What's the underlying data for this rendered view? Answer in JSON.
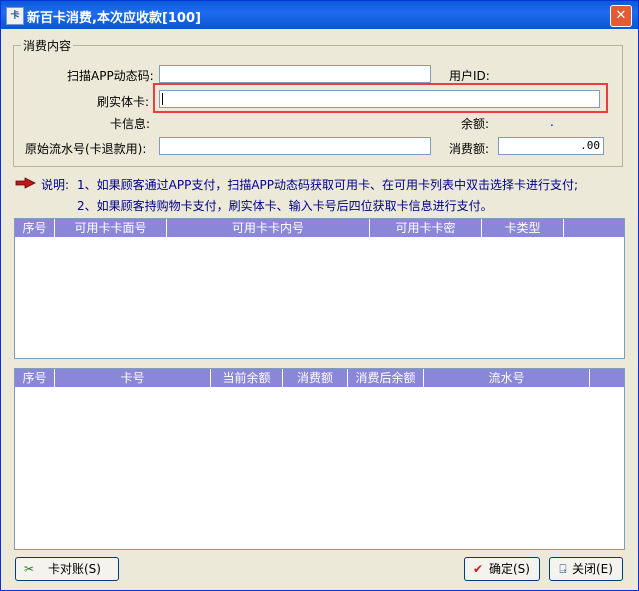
{
  "window": {
    "title": "新百卡消费,本次应收款[100]",
    "close_label": "✕"
  },
  "group": {
    "legend": "消费内容"
  },
  "form": {
    "scan_label": "扫描APP动态码:",
    "user_id_label": "用户ID:",
    "swipe_label": "刷实体卡:",
    "card_info_label": "卡信息:",
    "balance_label": "余额:",
    "balance_value": ".",
    "serial_label": "原始流水号(卡退款用):",
    "amount_label": "消费额:",
    "amount_value": ".00"
  },
  "notes": {
    "prefix": "说明:",
    "line1": "1、如果顾客通过APP支付，扫描APP动态码获取可用卡、在可用卡列表中双击选择卡进行支付;",
    "line2": "2、如果顾客持购物卡支付，刷实体卡、输入卡号后四位获取卡信息进行支付。"
  },
  "table1": {
    "columns": [
      "序号",
      "可用卡卡面号",
      "可用卡卡内号",
      "可用卡卡密",
      "卡类型"
    ]
  },
  "table2": {
    "columns": [
      "序号",
      "卡号",
      "当前余额",
      "消费额",
      "消费后余额",
      "流水号"
    ]
  },
  "buttons": {
    "reconcile": "卡对账(S)",
    "confirm": "确定(S)",
    "close": "关闭(E)"
  },
  "colors": {
    "title_bar": "#0a5bd8",
    "header_bg": "#8a86d8",
    "note_text": "#00008b",
    "highlight": "#e84040"
  }
}
